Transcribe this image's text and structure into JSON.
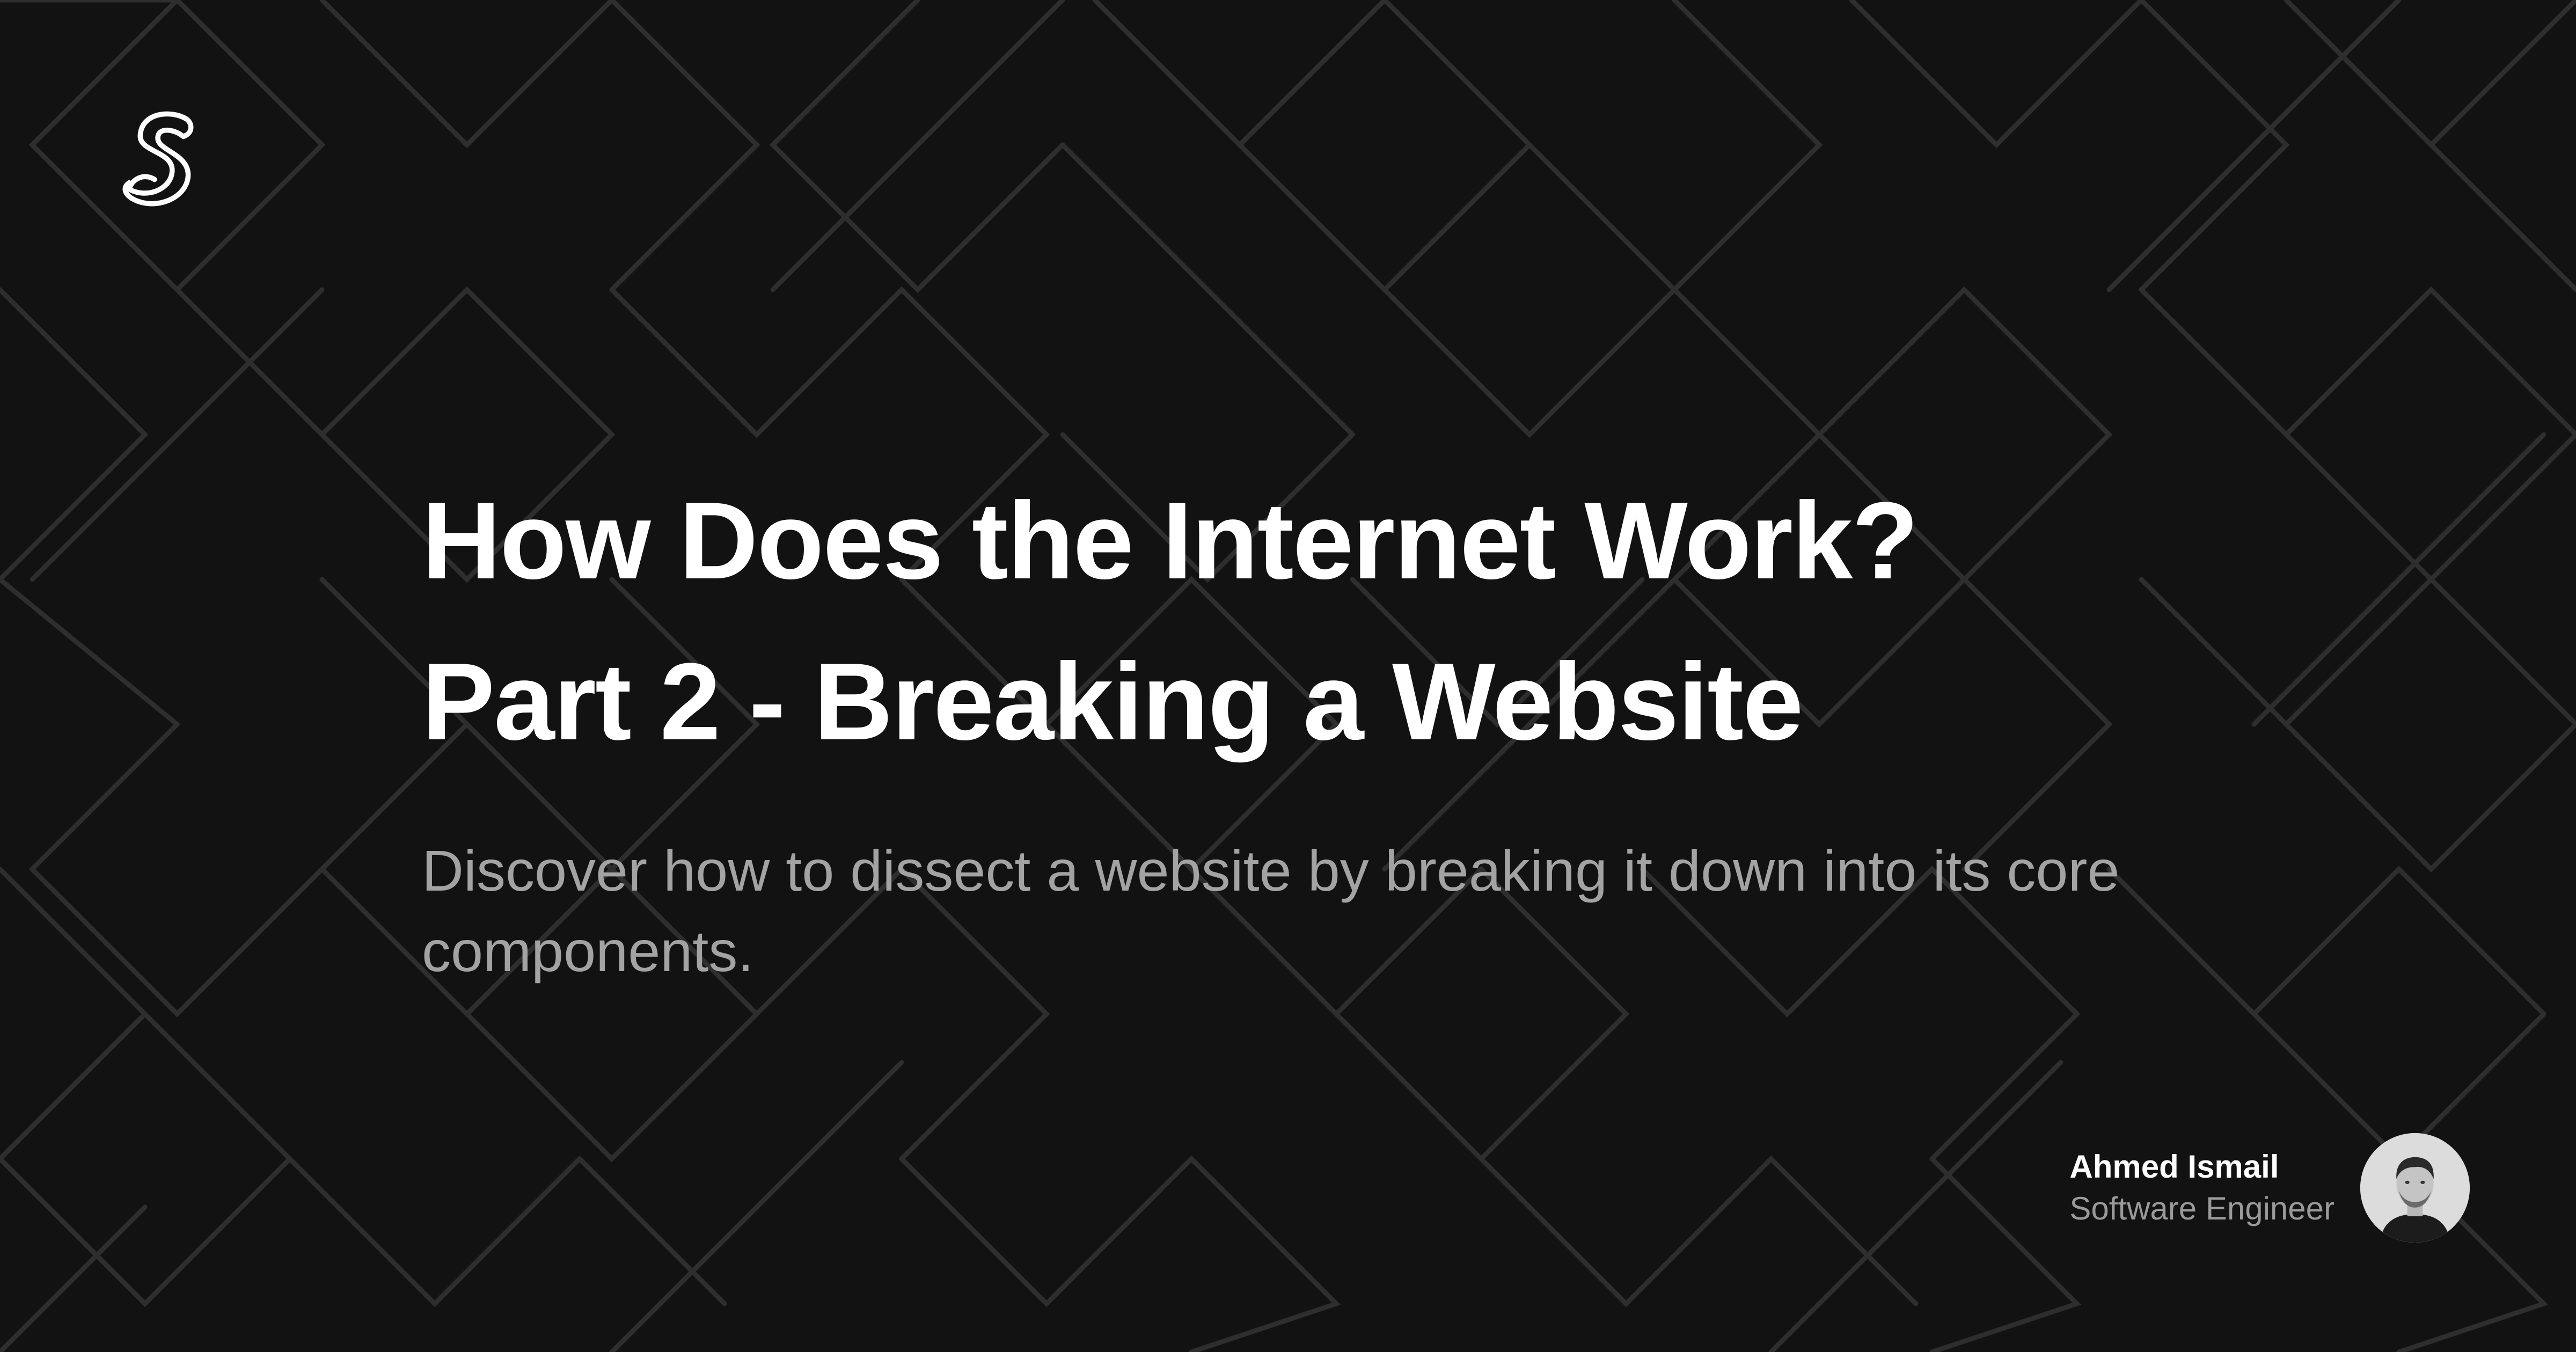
{
  "card": {
    "title_line_1": "How Does the Internet Work?",
    "title_line_2": "Part 2 - Breaking a Website",
    "description": "Discover how to dissect a website by breaking it down into its core components."
  },
  "author": {
    "name": "Ahmed Ismail",
    "role": "Software Engineer"
  },
  "icons": {
    "logo": "s-logo-icon",
    "avatar": "author-avatar"
  },
  "colors": {
    "background": "#121212",
    "title": "#ffffff",
    "description": "#a3a3a3",
    "role": "#9a9a9a",
    "pattern_line": "#2c2c2c"
  }
}
